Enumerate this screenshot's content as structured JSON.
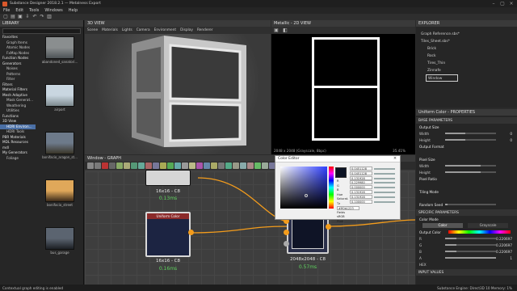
{
  "app": {
    "title": "Substance Designer 2018.2.1 — Metalness Export"
  },
  "menu": [
    "File",
    "Edit",
    "Tools",
    "Windows",
    "Help"
  ],
  "library": {
    "title": "LIBRARY",
    "tree": [
      {
        "label": "Favorites",
        "cat": true
      },
      {
        "label": "Graph Items",
        "cat": false
      },
      {
        "label": "Atomic Nodes",
        "cat": false
      },
      {
        "label": "FxMap Nodes",
        "cat": false
      },
      {
        "label": "Function Nodes",
        "cat": true
      },
      {
        "label": "Generators",
        "cat": true
      },
      {
        "label": "Noises",
        "cat": false
      },
      {
        "label": "Patterns",
        "cat": false
      },
      {
        "label": "Filter",
        "cat": false
      },
      {
        "label": "Filters",
        "cat": true
      },
      {
        "label": "Material Filters",
        "cat": true
      },
      {
        "label": "Mesh Adaptive",
        "cat": true
      },
      {
        "label": "Mask Generat...",
        "cat": false
      },
      {
        "label": "Weathering",
        "cat": false
      },
      {
        "label": "Utilities",
        "cat": false
      },
      {
        "label": "Functions",
        "cat": true
      },
      {
        "label": "3D View",
        "cat": true
      },
      {
        "label": "HDRI Environ...",
        "cat": false,
        "sel": true
      },
      {
        "label": "HDRI Tools",
        "cat": false
      },
      {
        "label": "PBR Materials",
        "cat": true
      },
      {
        "label": "MDL Resources",
        "cat": true
      },
      {
        "label": "mdl",
        "cat": true
      },
      {
        "label": "My Generators",
        "cat": true
      },
      {
        "label": "Foliage",
        "cat": false
      }
    ],
    "thumbs": [
      {
        "label": "abandoned_sanatori...",
        "c1": "#8a8e8f",
        "c2": "#4d5356"
      },
      {
        "label": "airport",
        "c1": "#c9d6e0",
        "c2": "#7d8a8f"
      },
      {
        "label": "bonifacio_aragon_st...",
        "c1": "#6d7a8a",
        "c2": "#3a3528"
      },
      {
        "label": "bonifacio_street",
        "c1": "#e0a85a",
        "c2": "#3b2a1a"
      },
      {
        "label": "bus_garage",
        "c1": "#5b6470",
        "c2": "#1c1f24"
      }
    ]
  },
  "view3d": {
    "title": "3D VIEW",
    "menus": [
      "Scene",
      "Materials",
      "Lights",
      "Camera",
      "Environment",
      "Display",
      "Renderer"
    ]
  },
  "view2d": {
    "title": "Metallic - 2D VIEW",
    "info": "2048 x 2048 (Grayscale, 8bpc)",
    "zoom": "35.41%"
  },
  "explorer": {
    "title": "EXPLORER",
    "items": [
      {
        "label": "Graph Reference.sbs*",
        "depth": 0
      },
      {
        "label": "Tiles_Sheet.sbs*",
        "depth": 0
      },
      {
        "label": "Brick",
        "depth": 1
      },
      {
        "label": "Rock",
        "depth": 1
      },
      {
        "label": "Tires_Thin",
        "depth": 1
      },
      {
        "label": "Zinnafe",
        "depth": 1
      },
      {
        "label": "Window",
        "depth": 1,
        "selected": true
      }
    ]
  },
  "properties": {
    "title": "Uniform Color - PROPERTIES",
    "base_section": "BASE PARAMETERS",
    "output_size": "Output Size",
    "width_label": "Width",
    "width_val": "0",
    "height_label": "Height",
    "height_val": "0",
    "output_format": "Output Format",
    "pixel_size": "Pixel Size",
    "ps_width": "Width",
    "ps_height": "Height",
    "pixel_ratio": "Pixel Ratio",
    "tiling": "Tiling Mode",
    "random_seed": "Random Seed",
    "specific_section": "SPECIFIC PARAMETERS",
    "color_mode": "Color Mode",
    "color_opt": "Color",
    "grayscale_opt": "Grayscale",
    "output_color": "Output Color",
    "oc_rows": [
      "R",
      "G",
      "B",
      "A"
    ],
    "oc_vals": [
      "0.220697",
      "0.220697",
      "0.220697",
      "1"
    ],
    "pixel_label": "Pixel",
    "hex_label": "HEX",
    "input_values": "INPUT VALUES"
  },
  "graph": {
    "title": "Window - GRAPH",
    "node_uniform_label": "Uniform Color",
    "node1_size": "16x16 - C8",
    "node1_time": "0.13ms",
    "node2_size": "16x16 - C8",
    "node2_time": "0.16ms",
    "node3_size": "2048x2048 - C8",
    "node3_time": "0.57ms",
    "uniform_color": "#1c2442",
    "accent": "#f39c1c"
  },
  "color_editor": {
    "title": "Color Editor",
    "labels": [
      "R",
      "G",
      "B",
      "Hue",
      "Saturat.",
      "Tz",
      "Color",
      "Fields",
      "sRGB",
      "Pixel"
    ],
    "values": [
      "0.0451128",
      "0.0451128",
      "0.131928",
      "0.229980",
      "0.000000",
      "0.131928",
      "0.131928",
      "0.100000"
    ],
    "hex": "#ff0b1223",
    "swatch": "#0b1223"
  },
  "status": {
    "text": "Contextual graph editing is enabled",
    "right": "Substance Engine: Direct3D 10    Memory: 1%"
  }
}
